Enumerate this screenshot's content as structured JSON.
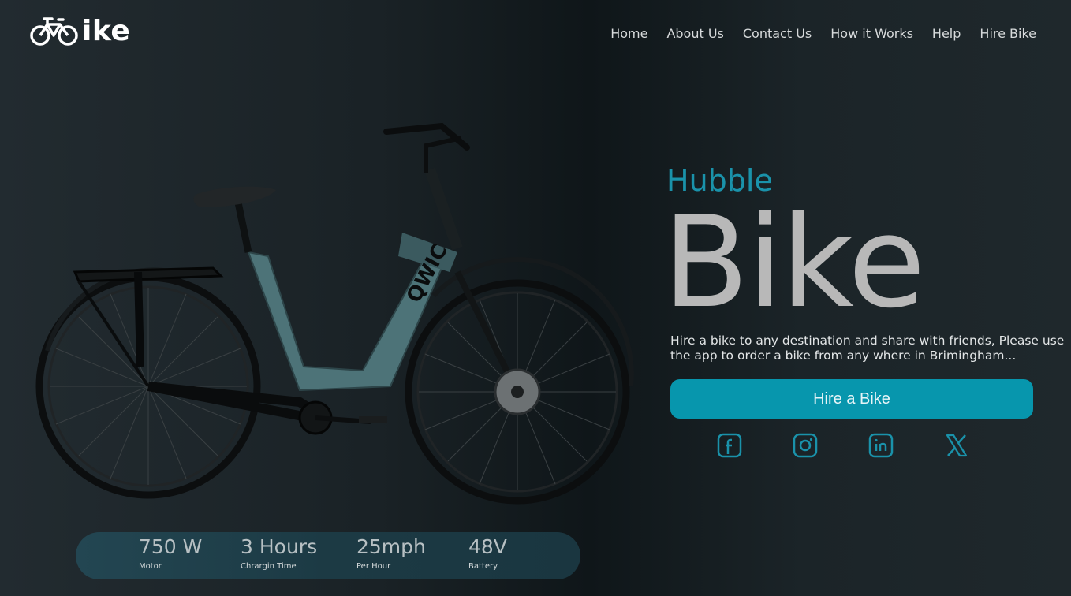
{
  "header": {
    "logo_text": "ike",
    "nav": [
      "Home",
      "About Us",
      "Contact Us",
      "How it Works",
      "Help",
      "Hire Bike"
    ]
  },
  "hero": {
    "subtitle": "Hubble",
    "title": "Bike",
    "description": "Hire a bike to any destination and share with friends, Please use the app to order a bike from any where in Brimingham...",
    "description_line1": "Hire a bike to any destination and share with friends, Please use",
    "description_line2": "the app to order a bike from any where in Brimingham...",
    "cta_label": "Hire a Bike",
    "bike_frame_text": "QWIC"
  },
  "socials": [
    {
      "icon": "facebook-icon"
    },
    {
      "icon": "instagram-icon"
    },
    {
      "icon": "linkedin-icon"
    },
    {
      "icon": "x-icon"
    }
  ],
  "stats": [
    {
      "value": "750 W",
      "label": "Motor"
    },
    {
      "value": "3 Hours",
      "label": "Chrargin Time"
    },
    {
      "value": "25mph",
      "label": "Per Hour"
    },
    {
      "value": "48V",
      "label": "Battery"
    }
  ],
  "colors": {
    "accent": "#0796ad",
    "subtitle": "#1a92aa",
    "title": "#b8b8b8",
    "background": "#1a2226",
    "bike_frame": "#4d7378"
  }
}
